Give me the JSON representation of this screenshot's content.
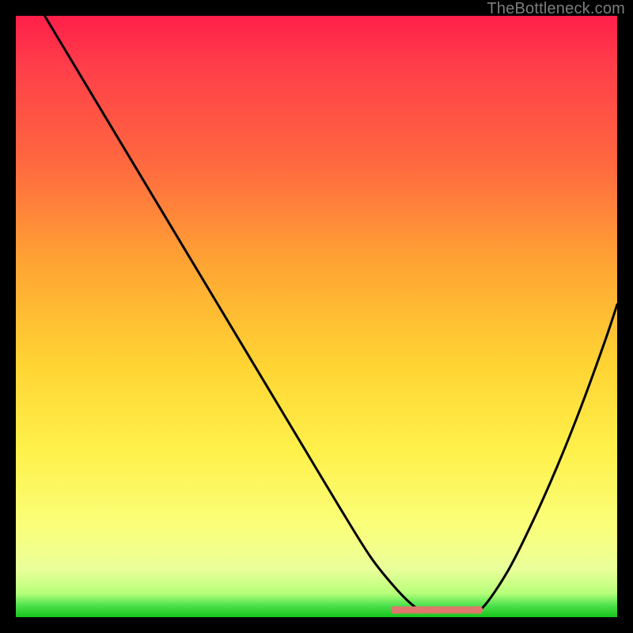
{
  "watermark": "TheBottleneck.com",
  "colors": {
    "page_bg": "#000000",
    "gradient_top": "#ff1f4a",
    "gradient_mid1": "#ffa733",
    "gradient_mid2": "#fff04a",
    "gradient_bottom": "#16c41a",
    "curve_stroke": "#000000",
    "flat_segment": "#e0776d",
    "watermark_text": "#7d7d7d"
  },
  "chart_data": {
    "type": "line",
    "title": "",
    "xlabel": "",
    "ylabel": "",
    "xlim": [
      0,
      100
    ],
    "ylim": [
      0,
      100
    ],
    "grid": false,
    "legend": false,
    "series": [
      {
        "name": "bottleneck-curve",
        "x": [
          0,
          6,
          12,
          18,
          24,
          30,
          36,
          42,
          48,
          54,
          59,
          63,
          66,
          68,
          72,
          76,
          78,
          82,
          86,
          90,
          94,
          98,
          100
        ],
        "y": [
          108,
          98,
          88,
          78,
          68,
          58,
          48,
          38,
          28,
          18,
          10,
          5,
          2,
          1,
          1,
          1,
          2,
          8,
          16,
          25,
          35,
          46,
          52
        ]
      }
    ],
    "annotations": [
      {
        "name": "flat-bottom-segment",
        "x_start": 63,
        "x_end": 77,
        "y": 1.2,
        "color": "#e0776d"
      }
    ],
    "notes": "y-values are interpreted as percentage of plot-area height from the bottom; values above 100 indicate the curve originates off the top edge."
  }
}
